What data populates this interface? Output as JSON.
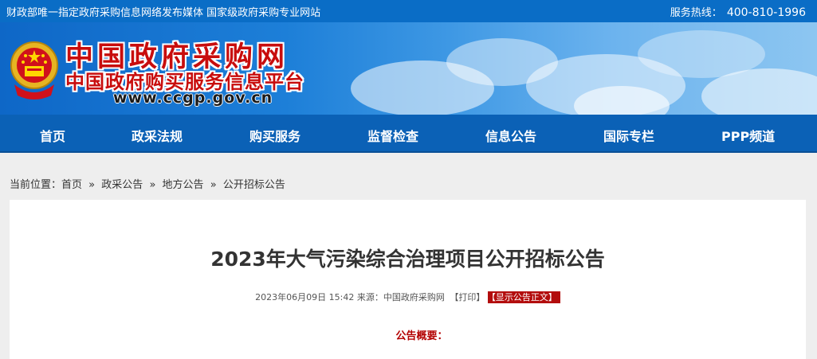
{
  "topbar": {
    "left_text": "财政部唯一指定政府采购信息网络发布媒体 国家级政府采购专业网站",
    "hotline_label": "服务热线：",
    "hotline_number": "400-810-1996"
  },
  "header": {
    "logo_title": "中国政府采购网",
    "logo_subtitle": "中国政府购买服务信息平台",
    "logo_url": "www.ccgp.gov.cn"
  },
  "nav": {
    "items": [
      "首页",
      "政采法规",
      "购买服务",
      "监督检查",
      "信息公告",
      "国际专栏",
      "PPP频道"
    ]
  },
  "breadcrumb": {
    "prefix": "当前位置：",
    "items": [
      "首页",
      "政采公告",
      "地方公告",
      "公开招标公告"
    ],
    "separator": "»"
  },
  "article": {
    "title": "2023年大气污染综合治理项目公开招标公告",
    "date": "2023年06月09日 15:42",
    "source_label": "来源：",
    "source": "中国政府采购网",
    "print_label": "【打印】",
    "show_text_label": "【显示公告正文】",
    "summary_heading": "公告概要："
  },
  "colors": {
    "topbar_bg": "#0a6dc6",
    "nav_bg": "#0b61b6",
    "logo_red": "#c80d0d",
    "accent_red": "#b30d0d"
  }
}
